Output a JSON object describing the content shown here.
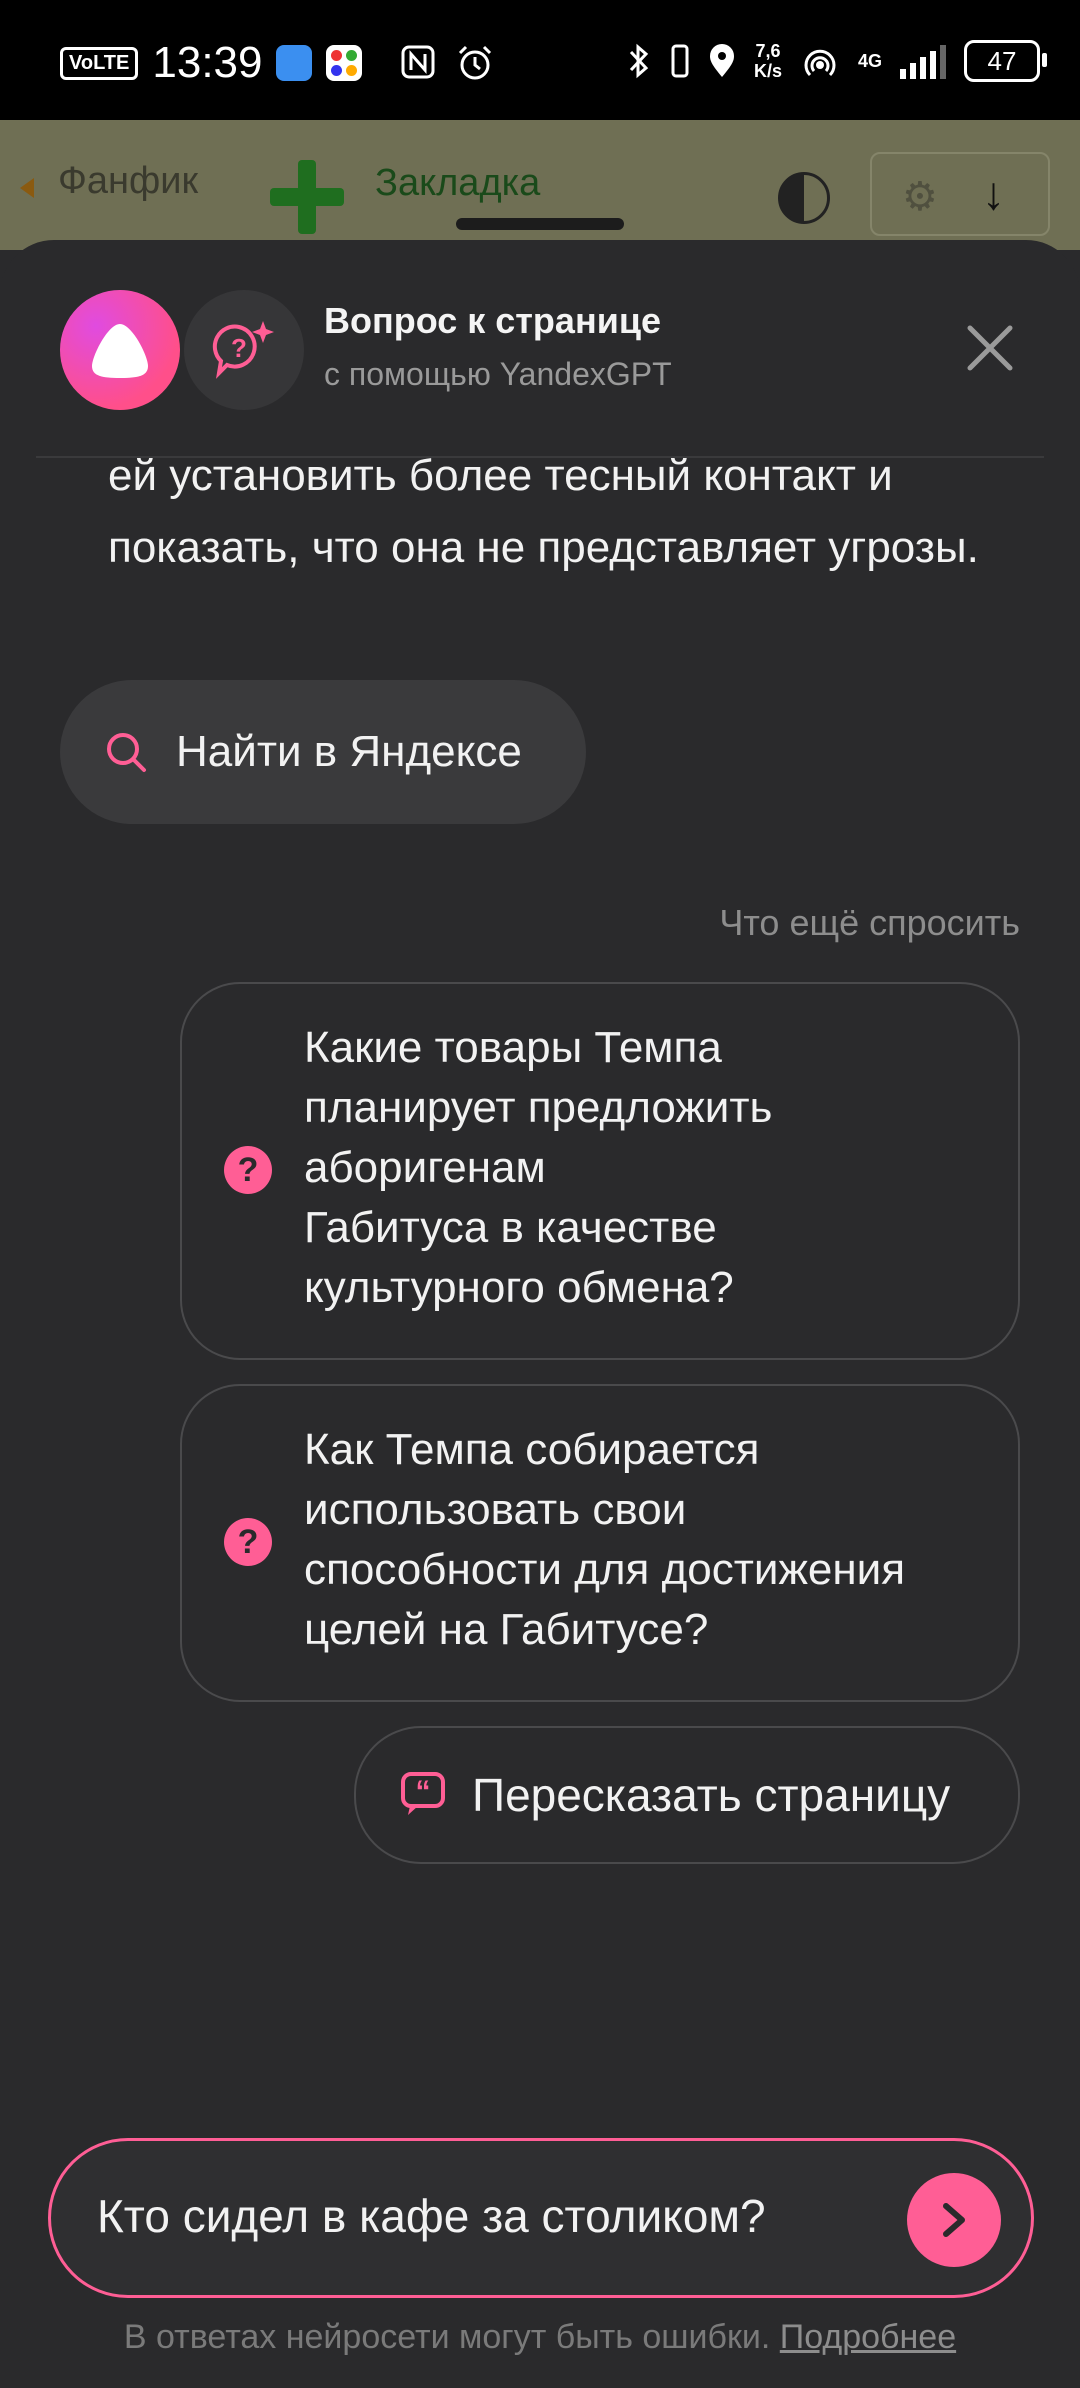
{
  "status_bar": {
    "volte": "VoLTE",
    "time": "13:39",
    "net_speed_value": "7,6",
    "net_speed_unit": "K/s",
    "network_type": "4G",
    "battery": "47"
  },
  "background_page": {
    "back_label": "Фанфик",
    "bookmark_label": "Закладка"
  },
  "header": {
    "title": "Вопрос к странице",
    "subtitle": "с помощью YandexGPT"
  },
  "answer": {
    "text": "ей установить более тесный контакт и показать, что она не представляет угрозы."
  },
  "search_button": {
    "label": "Найти в Яндексе"
  },
  "suggestions": {
    "heading": "Что ещё спросить",
    "items": [
      {
        "text": "Какие товары Темпа\nпланирует предложить\nаборигенам\nГабитуса в качестве\nкультурного обмена?"
      },
      {
        "text": "Как Темпа собирается\nиспользовать свои\nспособности для достижения\nцелей на Габитусе?"
      }
    ],
    "retell_label": "Пересказать страницу"
  },
  "input": {
    "value": "Кто сидел в кафе за столиком?"
  },
  "footer": {
    "disclaimer": "В ответах нейросети могут быть ошибки.",
    "link": "Подробнее"
  },
  "colors": {
    "accent": "#ff5e95",
    "sheet_bg": "#2a2a2c"
  }
}
